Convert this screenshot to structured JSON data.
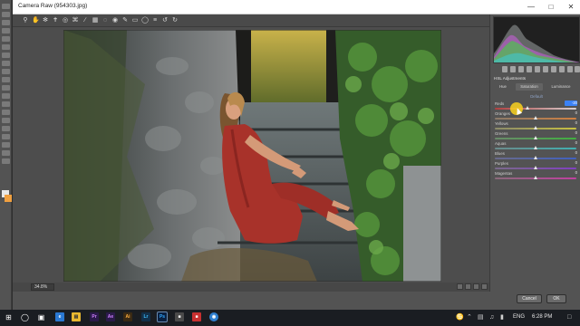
{
  "window": {
    "title": "Camera Raw (954303.jpg)"
  },
  "panel": {
    "header": "HSL Adjustments",
    "tabs": [
      "Hue",
      "Saturation",
      "Luminance"
    ],
    "active_tab": "Saturation",
    "default_label": "Default",
    "sliders": [
      {
        "label": "Reds",
        "value": "-20",
        "level": 0.4,
        "selected": true,
        "colors": [
          "#b04040",
          "#d8d0d0"
        ]
      },
      {
        "label": "Oranges",
        "value": "0",
        "level": 0.5,
        "colors": [
          "#8a7a6a",
          "#d08040"
        ]
      },
      {
        "label": "Yellows",
        "value": "0",
        "level": 0.5,
        "colors": [
          "#8a8a6a",
          "#c8c040"
        ]
      },
      {
        "label": "Greens",
        "value": "0",
        "level": 0.5,
        "colors": [
          "#6a8a6a",
          "#40b040"
        ]
      },
      {
        "label": "Aquas",
        "value": "0",
        "level": 0.5,
        "colors": [
          "#6a8a8a",
          "#40b0b0"
        ]
      },
      {
        "label": "Blues",
        "value": "0",
        "level": 0.5,
        "colors": [
          "#6a6a8a",
          "#4060c0"
        ]
      },
      {
        "label": "Purples",
        "value": "0",
        "level": 0.5,
        "colors": [
          "#7a6a8a",
          "#8040c0"
        ]
      },
      {
        "label": "Magentas",
        "value": "0",
        "level": 0.5,
        "colors": [
          "#8a6a7a",
          "#c040a0"
        ]
      }
    ]
  },
  "status": {
    "zoom": "34.8%"
  },
  "buttons": {
    "cancel": "Cancel",
    "ok": "OK"
  },
  "taskbar": {
    "language": "ENG",
    "time": "6:28 PM"
  },
  "colors": {
    "accent": "#3b82f6",
    "panel_bg": "#535353",
    "dress": "#a8322a"
  }
}
